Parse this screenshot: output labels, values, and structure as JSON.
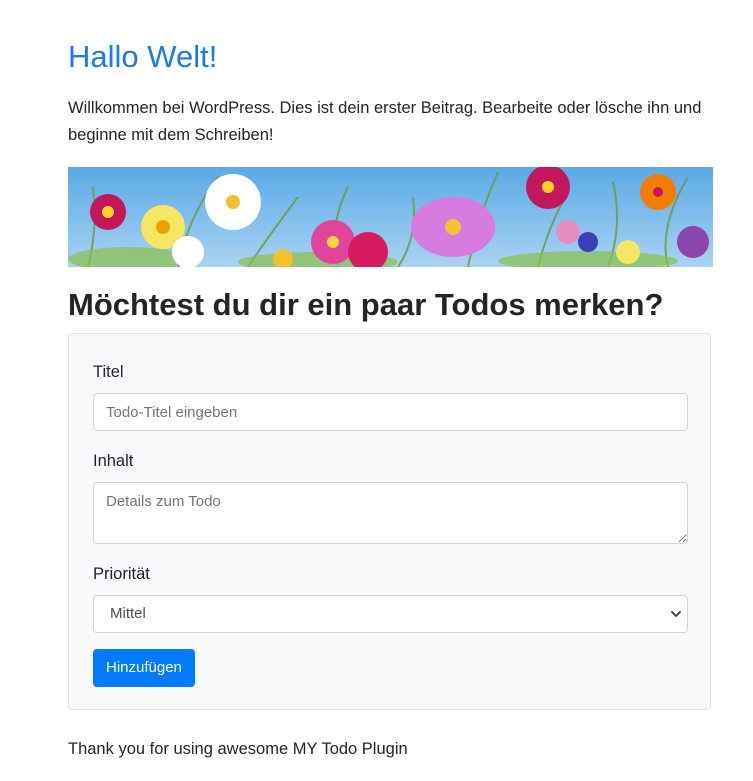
{
  "post": {
    "title": "Hallo Welt!",
    "body": "Willkommen bei WordPress. Dies ist dein erster Beitrag. Bearbeite oder lösche ihn und beginne mit dem Schreiben!"
  },
  "todo_form": {
    "heading": "Möchtest du dir ein paar Todos merken?",
    "title_label": "Titel",
    "title_placeholder": "Todo-Titel eingeben",
    "title_value": "",
    "content_label": "Inhalt",
    "content_placeholder": "Details zum Todo",
    "content_value": "",
    "priority_label": "Priorität",
    "priority_selected": "Mittel",
    "submit_label": "Hinzufügen"
  },
  "footer": {
    "text": "Thank you for using awesome MY Todo Plugin"
  },
  "colors": {
    "link_blue": "#1a7ae8",
    "primary_button": "#007bff",
    "card_background": "#f8f9fa"
  }
}
